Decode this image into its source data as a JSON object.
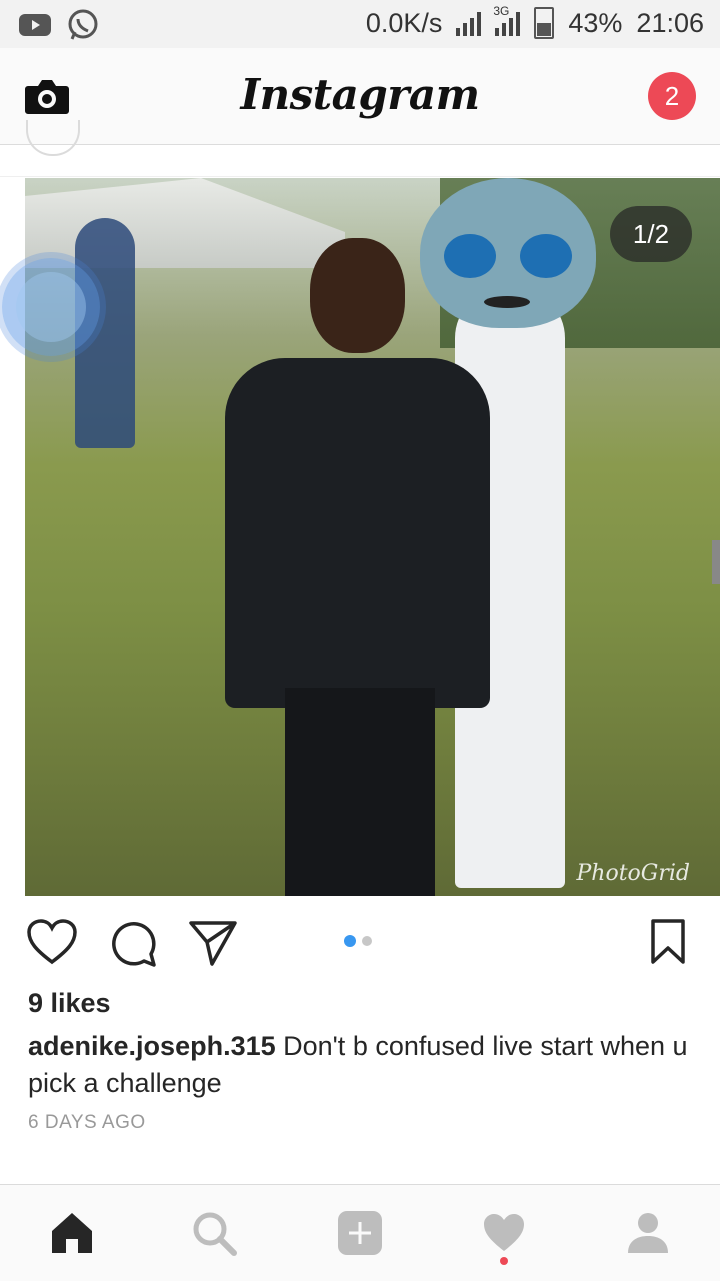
{
  "status_bar": {
    "speed": "0.0K/s",
    "network": "3G",
    "battery": "43%",
    "time": "21:06"
  },
  "header": {
    "title": "Instagram",
    "notification_count": "2"
  },
  "post": {
    "photo_counter": "1/2",
    "watermark": "PhotoGrid",
    "likes": "9 likes",
    "username": "adenike.joseph.315",
    "caption": " Don't b confused live start when u pick a challenge",
    "timestamp": "6 DAYS AGO",
    "carousel": {
      "total": 2,
      "current": 1
    }
  },
  "colors": {
    "accent": "#3897f0",
    "badge": "#ed4956",
    "text": "#262626"
  },
  "bottom_nav": {
    "items": [
      "home-icon",
      "search-icon",
      "add-icon",
      "activity-icon",
      "profile-icon"
    ]
  }
}
